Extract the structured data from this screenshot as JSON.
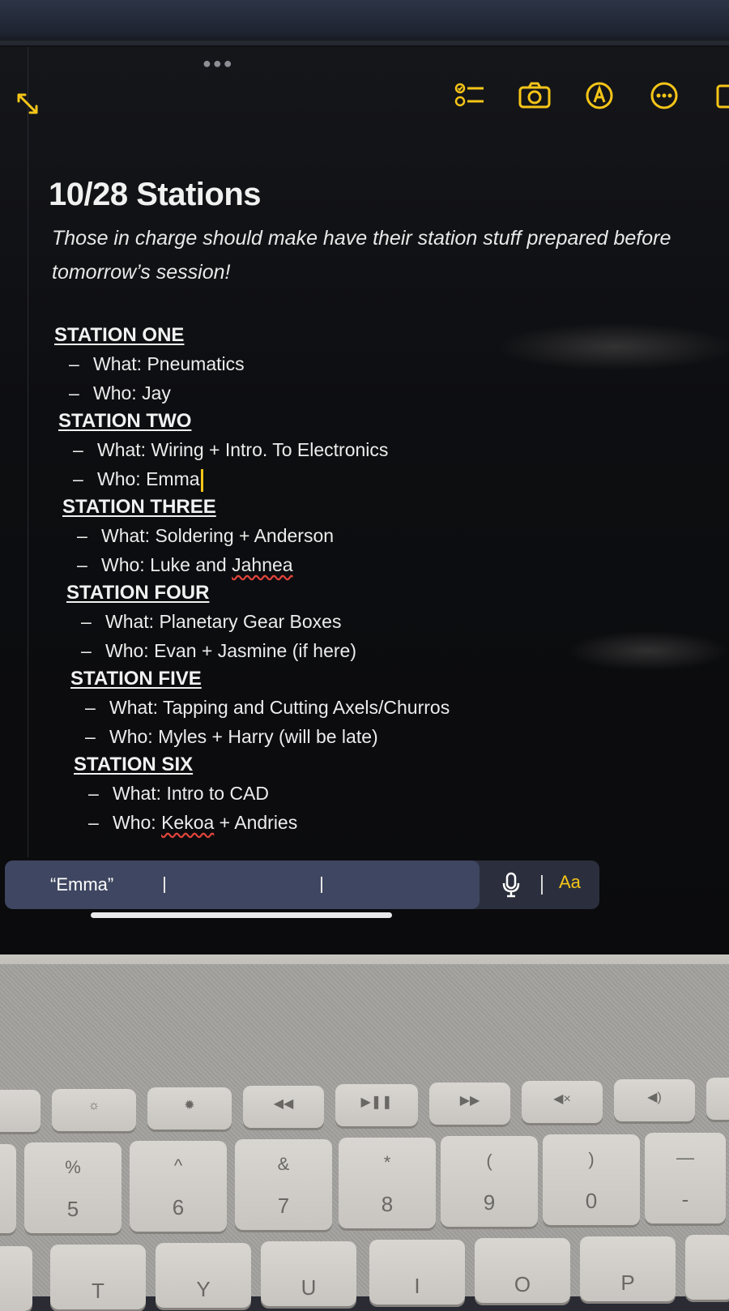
{
  "note": {
    "title": "10/28 Stations",
    "subtitle_line1": "Those in charge should make have their station stuff prepared before",
    "subtitle_line2": "tomorrow’s session!",
    "stations": [
      {
        "heading": "STATION ONE",
        "what": "What: Pneumatics",
        "who": "Who: Jay"
      },
      {
        "heading": "STATION TWO",
        "what": "What: Wiring + Intro. To Electronics",
        "who": "Who: Emma"
      },
      {
        "heading": "STATION THREE",
        "what": "What: Soldering + Anderson",
        "who_prefix": "Who: Luke and ",
        "who_misspelled": "Jahnea"
      },
      {
        "heading": "STATION FOUR",
        "what": "What: Planetary Gear Boxes",
        "who": "Who: Evan + Jasmine (if here)"
      },
      {
        "heading": "STATION FIVE",
        "what": "What: Tapping and Cutting Axels/Churros",
        "who": "Who: Myles + Harry (will be late)"
      },
      {
        "heading": "STATION SIX",
        "what": "What: Intro to CAD",
        "who_prefix": "Who: ",
        "who_misspelled": "Kekoa",
        "who_suffix": " + Andries"
      }
    ]
  },
  "suggestion_bar": {
    "suggestion": "“Emma”",
    "format_label": "Aa"
  },
  "toolbar": {
    "icons": [
      "checklist-icon",
      "camera-icon",
      "markup-icon",
      "more-icon",
      "compose-icon"
    ]
  },
  "keyboard": {
    "function_row": [
      "brightness-down",
      "brightness-up",
      "rewind",
      "play-pause",
      "fast-forward",
      "mute",
      "volume-down"
    ],
    "number_row": [
      {
        "top": "%",
        "bottom": "5"
      },
      {
        "top": "^",
        "bottom": "6"
      },
      {
        "top": "&",
        "bottom": "7"
      },
      {
        "top": "*",
        "bottom": "8"
      },
      {
        "top": "(",
        "bottom": "9"
      },
      {
        "top": ")",
        "bottom": "0"
      },
      {
        "top": "—",
        "bottom": "-"
      }
    ],
    "letter_row": [
      "T",
      "Y",
      "U",
      "I",
      "O",
      "P"
    ]
  },
  "colors": {
    "accent": "#f5c518",
    "note_background": "#0d0e11",
    "suggestion_pill": "#3e4661",
    "spellcheck": "#e0443c"
  }
}
